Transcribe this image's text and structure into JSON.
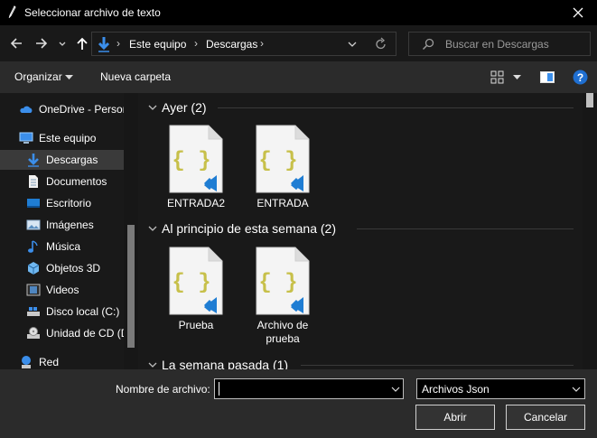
{
  "window": {
    "title": "Seleccionar archivo de texto"
  },
  "address": {
    "crumbs": [
      "Este equipo",
      "Descargas"
    ]
  },
  "search": {
    "placeholder": "Buscar en Descargas"
  },
  "toolbar": {
    "organize": "Organizar",
    "new_folder": "Nueva carpeta"
  },
  "sidebar": {
    "items": [
      {
        "label": "OneDrive - Person",
        "icon": "onedrive-icon"
      },
      {
        "label": "Este equipo",
        "icon": "computer-icon"
      },
      {
        "label": "Descargas",
        "icon": "downloads-icon",
        "selected": true
      },
      {
        "label": "Documentos",
        "icon": "documents-icon"
      },
      {
        "label": "Escritorio",
        "icon": "desktop-icon"
      },
      {
        "label": "Imágenes",
        "icon": "pictures-icon"
      },
      {
        "label": "Música",
        "icon": "music-icon"
      },
      {
        "label": "Objetos 3D",
        "icon": "objects3d-icon"
      },
      {
        "label": "Videos",
        "icon": "videos-icon"
      },
      {
        "label": "Disco local (C:)",
        "icon": "local-disk-icon"
      },
      {
        "label": "Unidad de CD (D:",
        "icon": "cd-drive-icon"
      },
      {
        "label": "Red",
        "icon": "network-icon"
      }
    ]
  },
  "groups": [
    {
      "label": "Ayer (2)",
      "files": [
        "ENTRADA2",
        "ENTRADA"
      ]
    },
    {
      "label": "Al principio de esta semana (2)",
      "files": [
        "Prueba",
        "Archivo de prueba"
      ]
    },
    {
      "label": "La semana pasada (1)",
      "files": []
    }
  ],
  "footer": {
    "filename_label": "Nombre de archivo:",
    "filename_value": "",
    "filetype_value": "Archivos Json",
    "open_label": "Abrir",
    "cancel_label": "Cancelar"
  },
  "colors": {
    "accent": "#3b8eea",
    "json_yellow": "#c7c04a",
    "vscode_blue": "#1f7dd3"
  }
}
